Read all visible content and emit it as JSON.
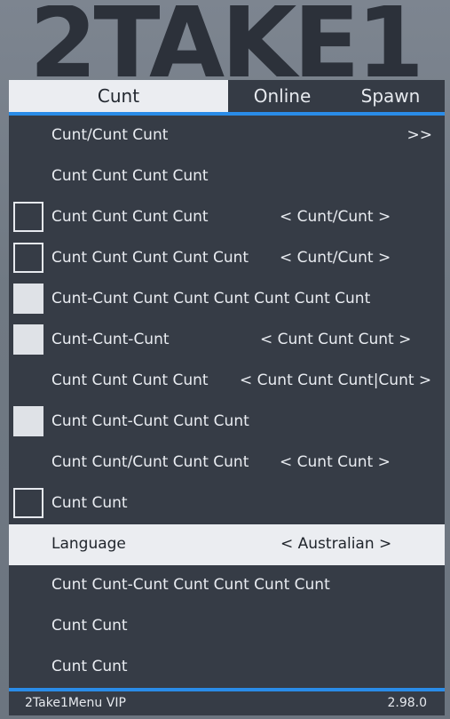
{
  "logo": {
    "text": "2TAKE1"
  },
  "tabs": [
    {
      "label": "Cunt",
      "active": true
    },
    {
      "label": "Online",
      "active": false
    },
    {
      "label": "Spawn",
      "active": false
    }
  ],
  "menu": {
    "items": [
      {
        "label": "Cunt/Cunt Cunt",
        "value": ">>",
        "checkbox": "none"
      },
      {
        "label": "Cunt Cunt Cunt Cunt",
        "value": "",
        "checkbox": "none"
      },
      {
        "label": "Cunt Cunt Cunt Cunt",
        "value": "< Cunt/Cunt >",
        "checkbox": "unchecked"
      },
      {
        "label": "Cunt Cunt Cunt Cunt Cunt",
        "value": "< Cunt/Cunt >",
        "checkbox": "unchecked"
      },
      {
        "label": "Cunt-Cunt Cunt Cunt Cunt Cunt Cunt Cunt",
        "value": "",
        "checkbox": "checked"
      },
      {
        "label": "Cunt-Cunt-Cunt",
        "value": "< Cunt Cunt Cunt >",
        "checkbox": "checked"
      },
      {
        "label": "Cunt Cunt Cunt Cunt",
        "value": "< Cunt Cunt Cunt|Cunt >",
        "checkbox": "none"
      },
      {
        "label": "Cunt Cunt-Cunt Cunt Cunt",
        "value": "",
        "checkbox": "checked"
      },
      {
        "label": "Cunt Cunt/Cunt Cunt Cunt",
        "value": "< Cunt Cunt >",
        "checkbox": "none"
      },
      {
        "label": "Cunt Cunt",
        "value": "",
        "checkbox": "unchecked"
      },
      {
        "label": "Language",
        "value": "< Australian >",
        "checkbox": "none",
        "selected": true
      },
      {
        "label": "Cunt Cunt-Cunt Cunt Cunt Cunt Cunt",
        "value": "",
        "checkbox": "none"
      },
      {
        "label": "Cunt Cunt",
        "value": "",
        "checkbox": "none"
      },
      {
        "label": "Cunt Cunt",
        "value": "",
        "checkbox": "none"
      }
    ]
  },
  "footer": {
    "left": "2Take1Menu VIP",
    "right": "2.98.0"
  },
  "colors": {
    "accent": "#2a8ce8",
    "panel": "#363c46",
    "selected_bg": "#ebedf1",
    "text": "#e9ecf1"
  }
}
